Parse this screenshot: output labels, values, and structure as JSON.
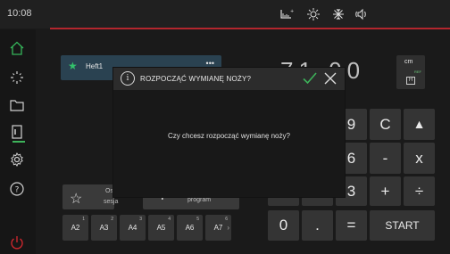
{
  "topbar": {
    "time": "10:08",
    "icons": [
      "label-printer-icon",
      "brightness-icon",
      "ventilation-icon",
      "volume-icon"
    ]
  },
  "sidebar": {
    "items": [
      "home-icon",
      "crosshair-icon",
      "folder-icon",
      "door-icon",
      "settings-icon",
      "help-icon",
      "power-icon"
    ],
    "active_indicator_color": "#3db35a"
  },
  "program_list": {
    "items": [
      {
        "name": "Heft1",
        "favorite": true
      }
    ],
    "more": "•••"
  },
  "bottom_buttons": {
    "session_label_1": "Ost",
    "session_label_2": "sesja",
    "program_label": "program"
  },
  "quick_buttons": [
    {
      "label": "A2",
      "sup": "1"
    },
    {
      "label": "A3",
      "sup": "2"
    },
    {
      "label": "A4",
      "sup": "3"
    },
    {
      "label": "A5",
      "sup": "4"
    },
    {
      "label": "A6",
      "sup": "5"
    },
    {
      "label": "A7",
      "sup": "6"
    }
  ],
  "display": {
    "value": "71.00",
    "unit": "cm",
    "ref": "REF"
  },
  "keypad": {
    "row1": [
      "9",
      "C",
      "▲"
    ],
    "row2": [
      "6",
      "-",
      "x"
    ],
    "row3": [
      "3",
      "+",
      "÷"
    ],
    "row4": [
      "0",
      ".",
      "=",
      "START"
    ]
  },
  "modal": {
    "title": "ROZPOCZĄĆ WYMIANĘ NOŻY?",
    "message": "Czy chcesz rozpocząć wymianę noży?",
    "ok_color": "#3db35a"
  },
  "colors": {
    "accent_red": "#b3262d",
    "accent_green": "#3db35a"
  }
}
